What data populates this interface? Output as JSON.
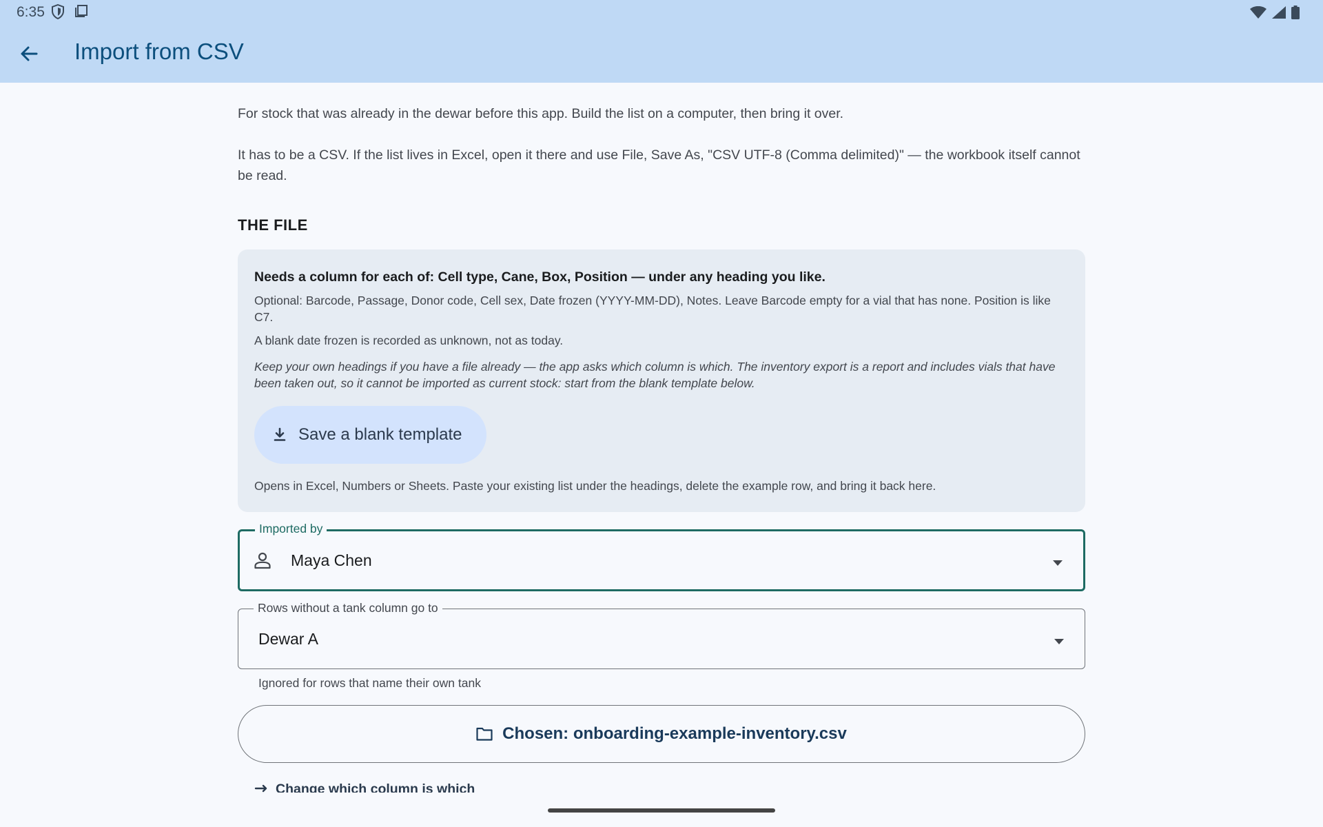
{
  "status": {
    "time": "6:35"
  },
  "header": {
    "title": "Import from CSV"
  },
  "intro": {
    "line1": "For stock that was already in the dewar before this app. Build the list on a computer, then bring it over.",
    "line2": "It has to be a CSV. If the list lives in Excel, open it there and use File, Save As, \"CSV UTF-8 (Comma delimited)\" — the workbook itself cannot be read."
  },
  "file_section": {
    "heading": "THE FILE",
    "required": "Needs a column for each of: Cell type, Cane, Box, Position — under any heading you like.",
    "optional": "Optional: Barcode, Passage, Donor code, Cell sex, Date frozen (YYYY-MM-DD), Notes. Leave Barcode empty for a vial that has none. Position is like C7.",
    "blank_date": "A blank date frozen is recorded as unknown, not as today.",
    "note": "Keep your own headings if you have a file already — the app asks which column is which. The inventory export is a report and includes vials that have been taken out, so it cannot be imported as current stock: start from the blank template below.",
    "template_button": "Save a blank template",
    "footnote": "Opens in Excel, Numbers or Sheets. Paste your existing list under the headings, delete the example row, and bring it back here."
  },
  "imported_by": {
    "label": "Imported by",
    "value": "Maya Chen"
  },
  "default_tank": {
    "label": "Rows without a tank column go to",
    "value": "Dewar A",
    "helper": "Ignored for rows that name their own tank"
  },
  "chosen_file": {
    "label": "Chosen: onboarding-example-inventory.csv"
  },
  "change_columns": {
    "label": "Change which column is which"
  },
  "colors": {
    "topbar": "#bfd9f5",
    "title": "#0c4f7d",
    "accent": "#1e6b63",
    "card": "#e6ecf3",
    "tonal_button": "#d3e3fd"
  }
}
